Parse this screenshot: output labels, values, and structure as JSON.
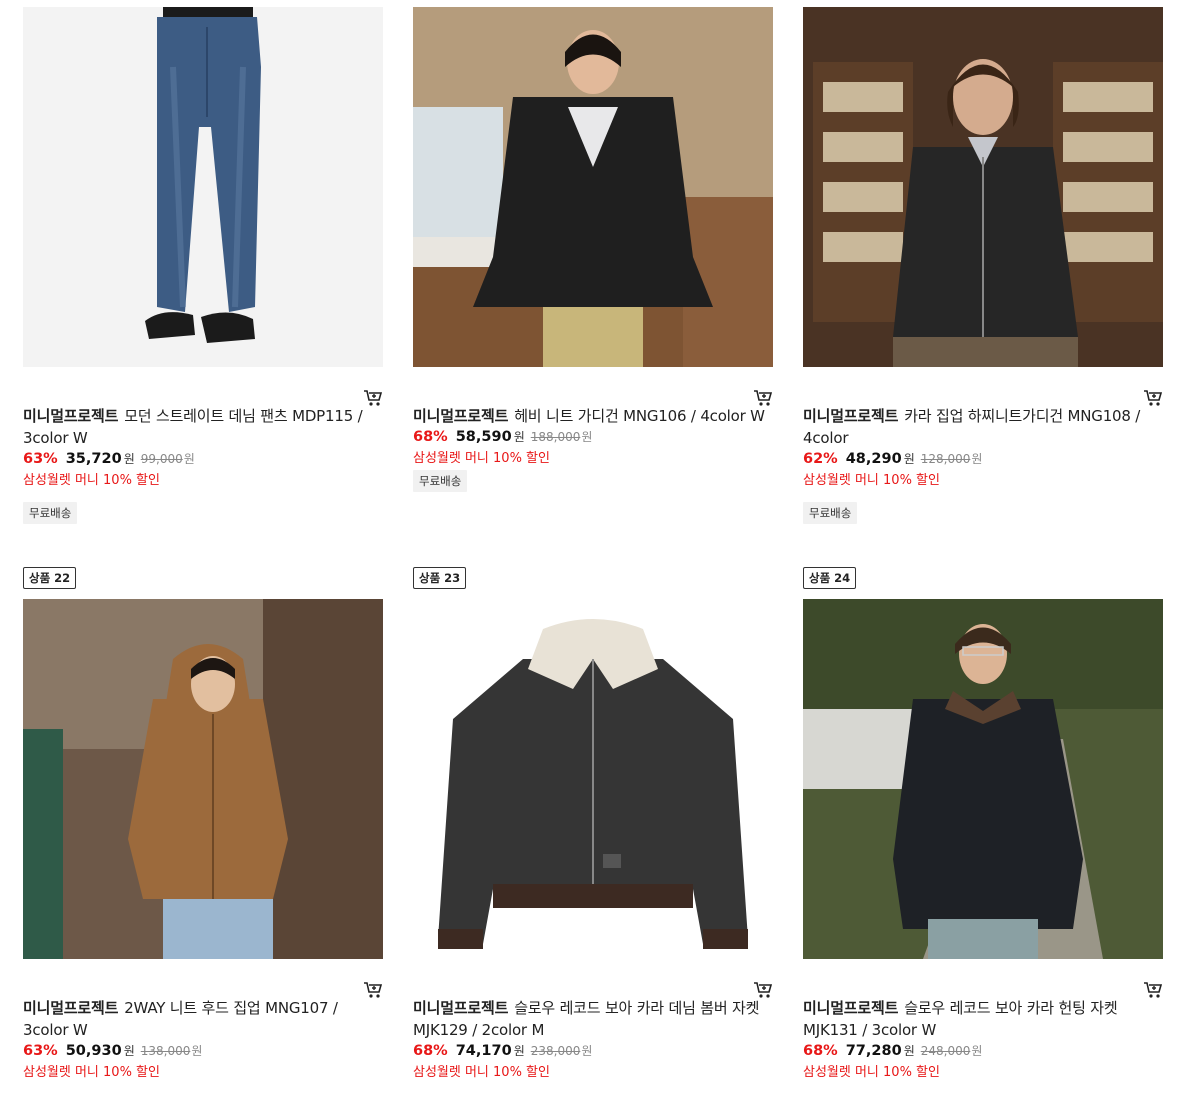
{
  "products": [
    {
      "brand": "미니멀프로젝트",
      "name": "모던 스트레이트 데님 팬츠 MDP115 / 3color W",
      "discount_rate": "63%",
      "price": "35,720",
      "price_unit": "원",
      "original_price": "99,000",
      "original_unit": "원",
      "promo": "삼성월렛 머니 10% 할인",
      "shipping_badge": "무료배송"
    },
    {
      "brand": "미니멀프로젝트",
      "name": "헤비 니트 가디건 MNG106 / 4color W",
      "discount_rate": "68%",
      "price": "58,590",
      "price_unit": "원",
      "original_price": "188,000",
      "original_unit": "원",
      "promo": "삼성월렛 머니 10% 할인",
      "shipping_badge": "무료배송"
    },
    {
      "brand": "미니멀프로젝트",
      "name": "카라 집업 하찌니트가디건 MNG108 / 4color",
      "discount_rate": "62%",
      "price": "48,290",
      "price_unit": "원",
      "original_price": "128,000",
      "original_unit": "원",
      "promo": "삼성월렛 머니 10% 할인",
      "shipping_badge": "무료배송"
    },
    {
      "rank_label": "상품 22",
      "brand": "미니멀프로젝트",
      "name": "2WAY 니트 후드 집업 MNG107 / 3color W",
      "discount_rate": "63%",
      "price": "50,930",
      "price_unit": "원",
      "original_price": "138,000",
      "original_unit": "원",
      "promo": "삼성월렛 머니 10% 할인"
    },
    {
      "rank_label": "상품 23",
      "brand": "미니멀프로젝트",
      "name": "슬로우 레코드 보아 카라 데님 봄버 자켓 MJK129 / 2color M",
      "discount_rate": "68%",
      "price": "74,170",
      "price_unit": "원",
      "original_price": "238,000",
      "original_unit": "원",
      "promo": "삼성월렛 머니 10% 할인"
    },
    {
      "rank_label": "상품 24",
      "brand": "미니멀프로젝트",
      "name": "슬로우 레코드 보아 카라 헌팅 자켓 MJK131 / 3color W",
      "discount_rate": "68%",
      "price": "77,280",
      "price_unit": "원",
      "original_price": "248,000",
      "original_unit": "원",
      "promo": "삼성월렛 머니 10% 할인"
    }
  ],
  "icons": {
    "cart": "cart-icon"
  },
  "colors": {
    "discount": "#e81818",
    "badge_bg": "#f1f1f1"
  }
}
